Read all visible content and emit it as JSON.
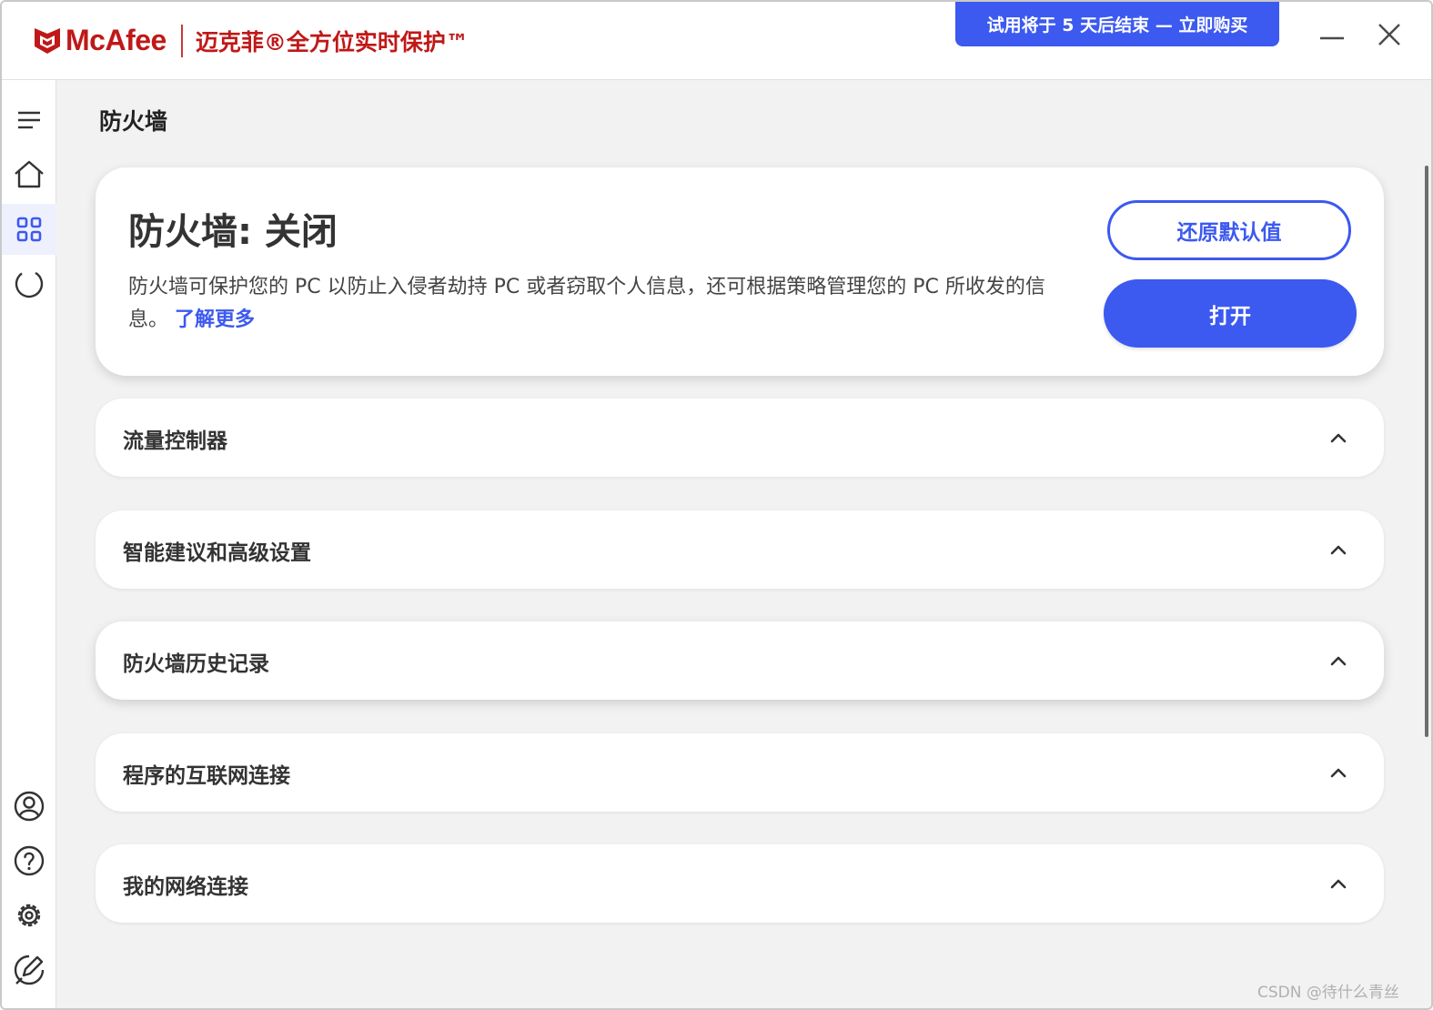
{
  "app": {
    "logo_text": "McAfee",
    "product_name": "迈克菲®全方位实时保护™",
    "trial_banner": "试用将于 5 天后结束 — 立即购买",
    "brand_color": "#c01818",
    "accent_color": "#3c59f0"
  },
  "sidebar": {
    "items": [
      {
        "name": "menu",
        "icon": "hamburger-icon"
      },
      {
        "name": "home",
        "icon": "home-icon"
      },
      {
        "name": "apps",
        "icon": "grid-icon",
        "active": true
      },
      {
        "name": "scan",
        "icon": "loading-ring-icon"
      },
      {
        "name": "account",
        "icon": "user-icon"
      },
      {
        "name": "help",
        "icon": "question-icon"
      },
      {
        "name": "settings",
        "icon": "gear-icon"
      },
      {
        "name": "feedback",
        "icon": "feedback-pen-icon"
      }
    ]
  },
  "page": {
    "title": "防火墙"
  },
  "firewall": {
    "status": "防火墙: 关闭",
    "description": "防火墙可保护您的 PC 以防止入侵者劫持 PC 或者窃取个人信息，还可根据策略管理您的 PC 所收发的信息。",
    "learn_more": "了解更多",
    "restore_label": "还原默认值",
    "open_label": "打开"
  },
  "sections": [
    {
      "label": "流量控制器"
    },
    {
      "label": "智能建议和高级设置"
    },
    {
      "label": "防火墙历史记录"
    },
    {
      "label": "程序的互联网连接"
    },
    {
      "label": "我的网络连接"
    }
  ],
  "watermark": "CSDN @待什么青丝"
}
